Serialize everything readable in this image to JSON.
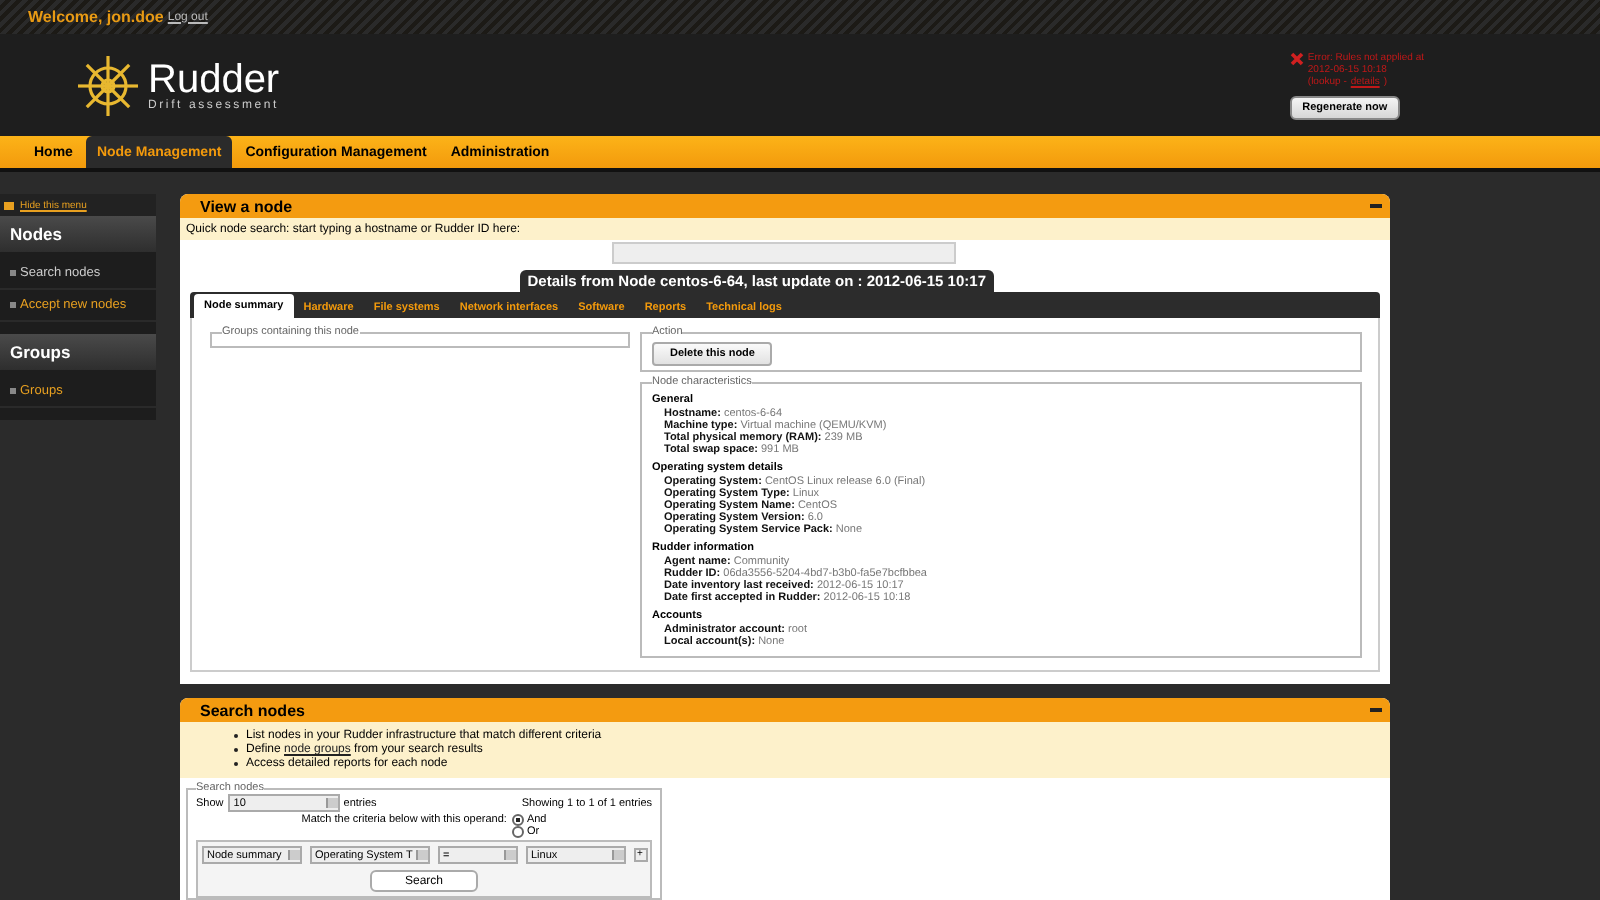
{
  "header": {
    "welcome": "Welcome, jon.doe",
    "logout": "Log out",
    "logo_title": "Rudder",
    "logo_subtitle": "Drift assessment",
    "error_lines": [
      "Error: Rules not applied at",
      "2012-06-15 10:18"
    ],
    "error_prefix": "(lookup - ",
    "error_link": "details",
    "error_suffix": ")",
    "regenerate_button": "Regenerate now"
  },
  "nav": [
    {
      "label": "Home",
      "selected": false
    },
    {
      "label": "Node Management",
      "selected": true
    },
    {
      "label": "Configuration Management",
      "selected": false
    },
    {
      "label": "Administration",
      "selected": false
    }
  ],
  "sidebar": {
    "hide_link": "Hide this menu",
    "sections": [
      {
        "title": "Nodes",
        "items": [
          {
            "label": "Search nodes",
            "selected": false
          },
          {
            "label": "Accept new nodes",
            "selected": true
          }
        ]
      },
      {
        "title": "Groups",
        "items": [
          {
            "label": "Groups",
            "selected": true
          }
        ]
      }
    ]
  },
  "view_node": {
    "title": "View a node",
    "hint": "Quick node search: start typing a hostname or Rudder ID here:",
    "details_title": "Details from Node centos-6-64, last update on : 2012-06-15 10:17",
    "tabs": [
      {
        "label": "Node summary",
        "selected": true
      },
      {
        "label": "Hardware",
        "selected": false
      },
      {
        "label": "File systems",
        "selected": false
      },
      {
        "label": "Network interfaces",
        "selected": false
      },
      {
        "label": "Software",
        "selected": false
      },
      {
        "label": "Reports",
        "selected": false
      },
      {
        "label": "Technical logs",
        "selected": false
      }
    ],
    "groups_legend": "Groups containing this node",
    "action_legend": "Action",
    "delete_button": "Delete this node",
    "characteristics_legend": "Node characteristics",
    "sections": [
      {
        "title": "General",
        "fields": [
          {
            "label": "Hostname:",
            "value": "centos-6-64"
          },
          {
            "label": "Machine type:",
            "value": "Virtual machine (QEMU/KVM)"
          },
          {
            "label": "Total physical memory (RAM):",
            "value": "239 MB"
          },
          {
            "label": "Total swap space:",
            "value": "991 MB"
          }
        ]
      },
      {
        "title": "Operating system details",
        "fields": [
          {
            "label": "Operating System:",
            "value": "CentOS Linux release 6.0 (Final)"
          },
          {
            "label": "Operating System Type:",
            "value": "Linux"
          },
          {
            "label": "Operating System Name:",
            "value": "CentOS"
          },
          {
            "label": "Operating System Version:",
            "value": "6.0"
          },
          {
            "label": "Operating System Service Pack:",
            "value": "None"
          }
        ]
      },
      {
        "title": "Rudder information",
        "fields": [
          {
            "label": "Agent name:",
            "value": "Community"
          },
          {
            "label": "Rudder ID:",
            "value": "06da3556-5204-4bd7-b3b0-fa5e7bcfbbea"
          },
          {
            "label": "Date inventory last received:",
            "value": "2012-06-15 10:17"
          },
          {
            "label": "Date first accepted in Rudder:",
            "value": "2012-06-15 10:18"
          }
        ]
      },
      {
        "title": "Accounts",
        "fields": [
          {
            "label": "Administrator account:",
            "value": "root"
          },
          {
            "label": "Local account(s):",
            "value": "None"
          }
        ]
      }
    ]
  },
  "search_nodes": {
    "title": "Search nodes",
    "bullets": [
      {
        "text": "List nodes in your Rudder infrastructure that match different criteria"
      },
      {
        "text": "Define ",
        "link": "node groups",
        "after": " from your search results"
      },
      {
        "text": "Access detailed reports for each node"
      }
    ],
    "legend": "Search nodes",
    "show_label": "Show",
    "page_size": "10",
    "entries_label": "entries",
    "info": "Showing 1 to 1 of 1 entries",
    "operand_label": "Match the criteria below with this operand:",
    "operands": [
      {
        "label": "And",
        "selected": true
      },
      {
        "label": "Or",
        "selected": false
      }
    ],
    "criteria": [
      "Node summary",
      "Operating System T",
      "=",
      "Linux"
    ],
    "add_button": "+",
    "search_button": "Search"
  }
}
